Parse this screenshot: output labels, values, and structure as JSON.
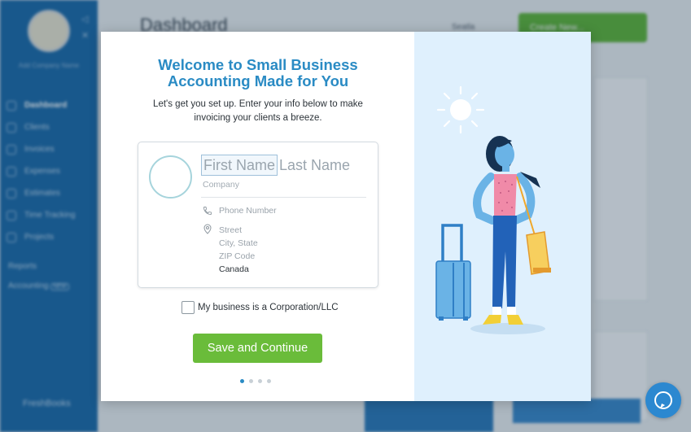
{
  "background": {
    "page_title": "Dashboard",
    "user_label": "Seatla",
    "create_button_label": "Create New...",
    "company_name": "Add Company Name",
    "nav": [
      {
        "label": "Dashboard",
        "active": true
      },
      {
        "label": "Clients",
        "active": false
      },
      {
        "label": "Invoices",
        "active": false
      },
      {
        "label": "Expenses",
        "active": false
      },
      {
        "label": "Estimates",
        "active": false
      },
      {
        "label": "Time Tracking",
        "active": false
      },
      {
        "label": "Projects",
        "active": false
      }
    ],
    "reports_label": "Reports",
    "accounting_label": "Accounting",
    "accounting_badge": "NEW",
    "brand_label": "FreshBooks"
  },
  "modal": {
    "title_line1": "Welcome to Small Business",
    "title_line2": "Accounting Made for You",
    "subtitle_line1": "Let's get you set up. Enter your info below to make",
    "subtitle_line2": "invoicing your clients a breeze.",
    "card": {
      "first_name_placeholder": "First Name",
      "last_name_placeholder": "Last Name",
      "company_placeholder": "Company",
      "phone_placeholder": "Phone Number",
      "street_placeholder": "Street",
      "city_state_placeholder": "City, State",
      "zip_placeholder": "ZIP Code",
      "country": "Canada"
    },
    "checkbox_label": "My business is a Corporation/LLC",
    "save_button_label": "Save and Continue",
    "pagination": {
      "total": 4,
      "current": 1
    }
  },
  "colors": {
    "accent_blue": "#2a8bc4",
    "primary_green": "#6abc3a",
    "sidebar_blue": "#1d6aa8",
    "illustration_bg": "#dff0fd"
  },
  "icons": {
    "phone": "phone-icon",
    "address": "location-pin-icon",
    "help": "help-chat-icon"
  }
}
